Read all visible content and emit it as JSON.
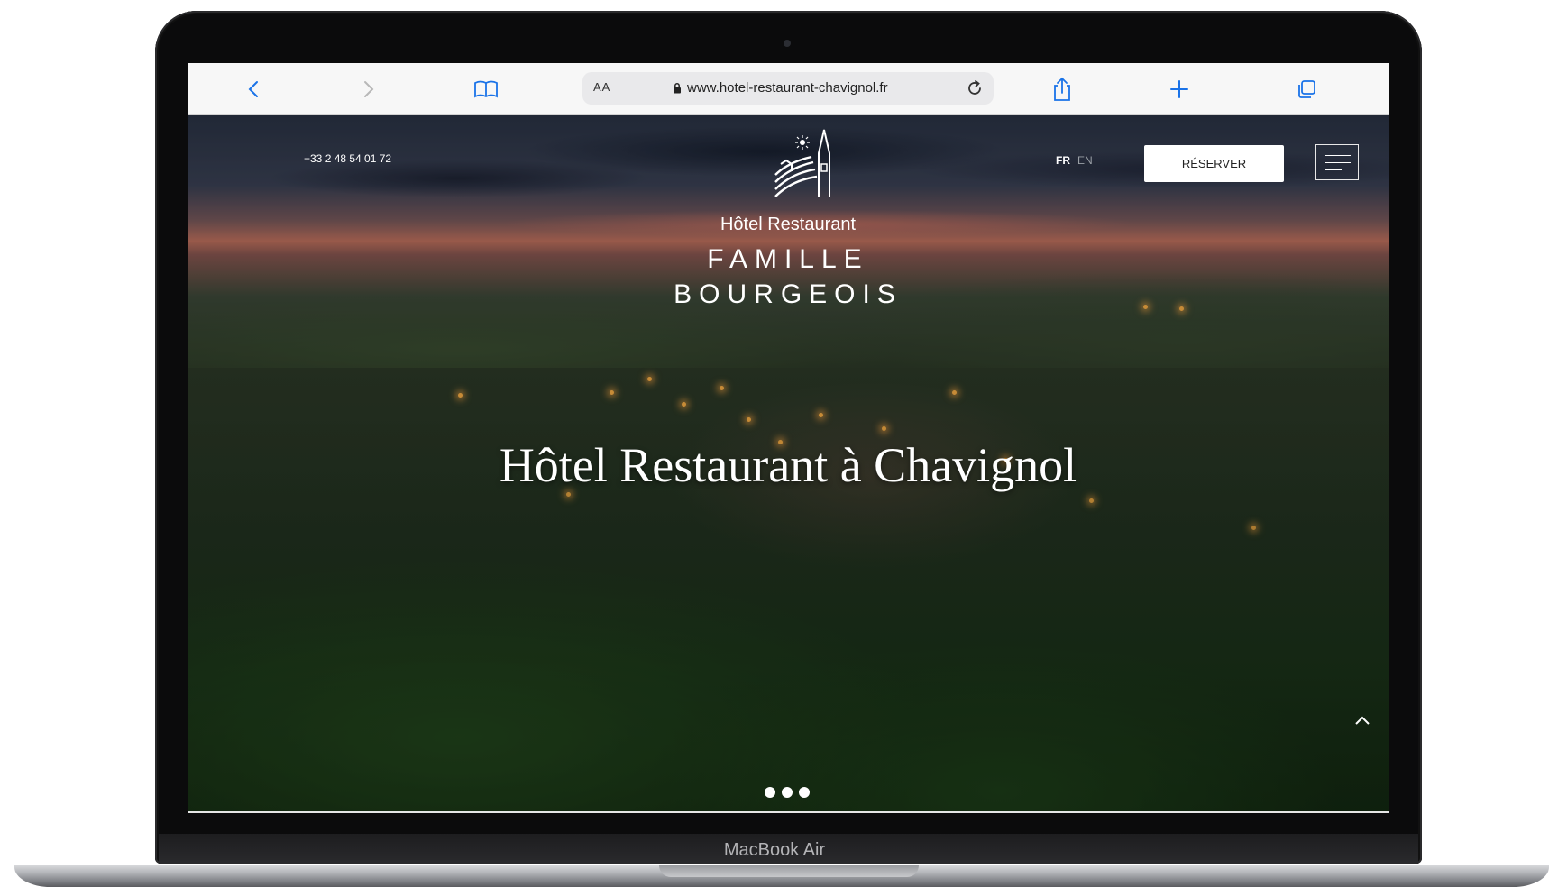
{
  "device": {
    "brand_label": "MacBook Air"
  },
  "browser": {
    "reader_toggle": "AA",
    "url": "www.hotel-restaurant-chavignol.fr",
    "icons": {
      "back": "chevron-left-icon",
      "forward": "chevron-right-icon",
      "bookmarks": "book-icon",
      "lock": "lock-icon",
      "reload": "reload-icon",
      "share": "share-icon",
      "new_tab": "plus-icon",
      "tabs": "tabs-icon"
    },
    "accent_color": "#1a73e8"
  },
  "site": {
    "phone": "+33 2 48 54 01 72",
    "logo_line1": "Hôtel Restaurant",
    "logo_line2": "FAMILLE",
    "logo_line3": "BOURGEOIS",
    "lang_fr": "FR",
    "lang_en": "EN",
    "reserve_label": "RÉSERVER",
    "headline": "Hôtel Restaurant à Chavignol",
    "slider_total": 3
  }
}
